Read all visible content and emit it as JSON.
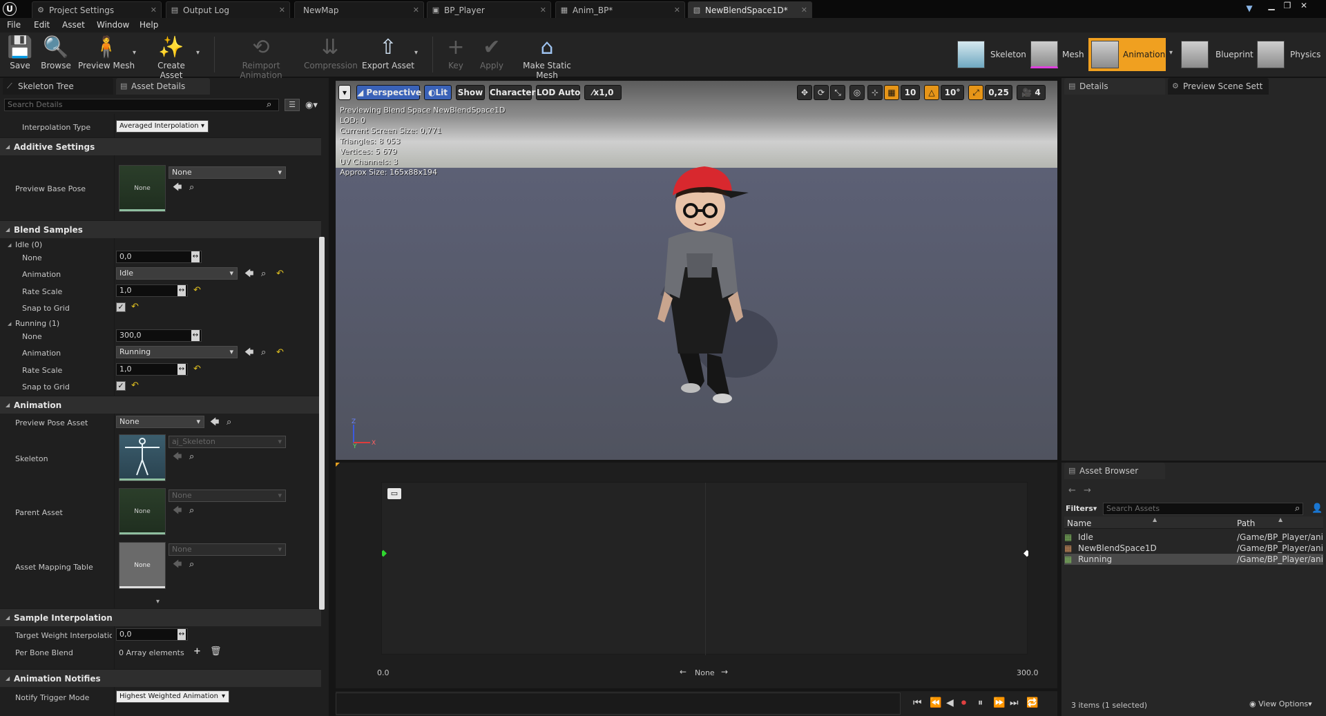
{
  "window": {
    "tabs": [
      {
        "label": "Project Settings",
        "icon": "gear-icon"
      },
      {
        "label": "Output Log",
        "icon": "log-icon"
      },
      {
        "label": "NewMap",
        "icon": ""
      },
      {
        "label": "BP_Player",
        "icon": "blueprint-icon"
      },
      {
        "label": "Anim_BP*",
        "icon": "anim-bp-icon"
      },
      {
        "label": "NewBlendSpace1D*",
        "icon": "blendspace-icon"
      }
    ],
    "active_tab": 5
  },
  "menu": [
    "File",
    "Edit",
    "Asset",
    "Window",
    "Help"
  ],
  "toolbar": {
    "save": "Save",
    "browse": "Browse",
    "preview_mesh": "Preview Mesh",
    "create_asset": "Create Asset",
    "reimport_animation": "Reimport Animation",
    "compression": "Compression",
    "export_asset": "Export Asset",
    "key": "Key",
    "apply": "Apply",
    "make_static_mesh": "Make Static Mesh"
  },
  "modes": {
    "skeleton": "Skeleton",
    "mesh": "Mesh",
    "animation": "Animation",
    "blueprint": "Blueprint",
    "physics": "Physics",
    "active": "Animation"
  },
  "left_panel": {
    "tabs": [
      "Skeleton Tree",
      "Asset Details"
    ],
    "search_placeholder": "Search Details",
    "interpolation_type_label": "Interpolation Type",
    "interpolation_type_value": "Averaged Interpolation",
    "additive_settings": "Additive Settings",
    "preview_base_pose_label": "Preview Base Pose",
    "none_thumb": "None",
    "preview_base_pose_value": "None",
    "blend_samples": "Blend Samples",
    "samples": [
      {
        "title": "Idle (0)",
        "none_label": "None",
        "none_value": "0,0",
        "animation_label": "Animation",
        "animation_value": "Idle",
        "rate_label": "Rate Scale",
        "rate_value": "1,0",
        "snap_label": "Snap to Grid",
        "snap_checked": true
      },
      {
        "title": "Running (1)",
        "none_label": "None",
        "none_value": "300,0",
        "animation_label": "Animation",
        "animation_value": "Running",
        "rate_label": "Rate Scale",
        "rate_value": "1,0",
        "snap_label": "Snap to Grid",
        "snap_checked": true
      }
    ],
    "animation": "Animation",
    "preview_pose_asset_label": "Preview Pose Asset",
    "preview_pose_asset_value": "None",
    "skeleton_label": "Skeleton",
    "skeleton_value": "aj_Skeleton",
    "parent_asset_label": "Parent Asset",
    "parent_asset_value": "None",
    "asset_mapping_label": "Asset Mapping Table",
    "asset_mapping_value": "None",
    "sample_interpolation": "Sample Interpolation",
    "target_weight_label": "Target Weight Interpolation S",
    "target_weight_value": "0,0",
    "per_bone_blend_label": "Per Bone Blend",
    "per_bone_blend_value": "0 Array elements",
    "animation_notifies": "Animation Notifies",
    "notify_trigger_label": "Notify Trigger Mode",
    "notify_trigger_value": "Highest Weighted Animation"
  },
  "viewport": {
    "perspective": "Perspective",
    "lit": "Lit",
    "show": "Show",
    "character": "Character",
    "lod": "LOD Auto",
    "speed": "x1,0",
    "grid_snap": "10",
    "rot_snap": "10°",
    "scale_snap": "0,25",
    "cam_speed": "4",
    "stats": [
      "Previewing Blend Space NewBlendSpace1D",
      "LOD: 0",
      "Current Screen Size: 0,771",
      "Triangles: 8 053",
      "Vertices: 5 679",
      "UV Channels: 3",
      "Approx Size: 165x88x194"
    ],
    "axis_z": "Z",
    "axis_y": "Y",
    "axis_x": "X"
  },
  "blend_graph": {
    "x_min": "0.0",
    "x_max": "300.0",
    "axis_label": "None",
    "x_range": [
      0,
      300
    ],
    "samples": [
      {
        "x": 0,
        "color": "#2fd62f"
      },
      {
        "x": 300,
        "color": "#ffffff"
      }
    ]
  },
  "right_panel": {
    "tabs": [
      "Details",
      "Preview Scene Sett"
    ]
  },
  "asset_browser": {
    "tab": "Asset Browser",
    "filters": "Filters",
    "search_placeholder": "Search Assets",
    "col_name": "Name",
    "col_path": "Path",
    "rows": [
      {
        "name": "Idle",
        "path": "/Game/BP_Player/ani",
        "selected": false
      },
      {
        "name": "NewBlendSpace1D",
        "path": "/Game/BP_Player/ani",
        "selected": false
      },
      {
        "name": "Running",
        "path": "/Game/BP_Player/ani",
        "selected": true
      }
    ],
    "status": "3 items (1 selected)",
    "view_options": "View Options"
  },
  "colors": {
    "accent_orange": "#f0a020",
    "selection_blue": "#3a62b8"
  }
}
